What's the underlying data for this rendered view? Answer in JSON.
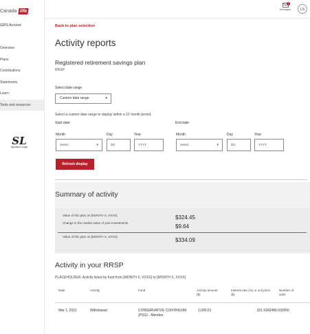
{
  "brand": {
    "logo_text": "Canada",
    "logo_mark": "life",
    "accent": "#b9202e"
  },
  "sidebar": {
    "access": "GRS Access",
    "items": [
      {
        "label": "Overview"
      },
      {
        "label": "Plans"
      },
      {
        "label": "Contributions"
      },
      {
        "label": "Statements"
      },
      {
        "label": "Learn"
      },
      {
        "label": "Tools and resources",
        "active": true
      }
    ],
    "badge_mark": "SL",
    "badge_sub": "Sponsor Logo"
  },
  "topbar": {
    "messages_label": "Messages",
    "messages_count": "1",
    "avatar_initials": "LS"
  },
  "page": {
    "back_link": "Back to plan selection",
    "title": "Activity reports",
    "plan_name": "Registered retirement savings plan",
    "plan_type": "RRSP",
    "date_range_label": "Select date range",
    "date_range_value": "Custom date range",
    "hint": "Select a custom date range to display within a 12 month period.",
    "start_label": "Start date",
    "end_label": "End date",
    "month_label": "Month",
    "day_label": "Day",
    "year_label": "Year",
    "month_placeholder": "Select",
    "day_placeholder": "DD",
    "year_placeholder": "YYYY",
    "refresh_label": "Refresh display"
  },
  "summary": {
    "title": "Summary of activity",
    "rows": [
      {
        "label": "Value of this plan on [MONTH X, XXXX]",
        "value": "$324.45"
      },
      {
        "label": "Change in the market value of your investments",
        "value": "$9.64"
      },
      {
        "label": "Value of this plan on [MONTH X, XXXX]",
        "value": "$334.09"
      }
    ]
  },
  "activity": {
    "title": "Activity in your RRSP",
    "description": "PLACEHOLDER. Activity listed by fund from [MONTH X, XXXX] to [MONTH X, XXXX]",
    "columns": {
      "date": "Date",
      "activity": "Activity",
      "fund": "Fund",
      "amount": "Activity amount ($)",
      "rate": "Interest rate (%) or unit price ($)",
      "units": "Number of units"
    },
    "rows": [
      {
        "date": "Mar 1, 2021",
        "activity": "Withdrawal",
        "fund": "CONSERVATIVE CONTINUUM (PSG) - Member",
        "amount": "1,000.51",
        "rate": "321.918248",
        "units": "0.032056"
      }
    ]
  }
}
